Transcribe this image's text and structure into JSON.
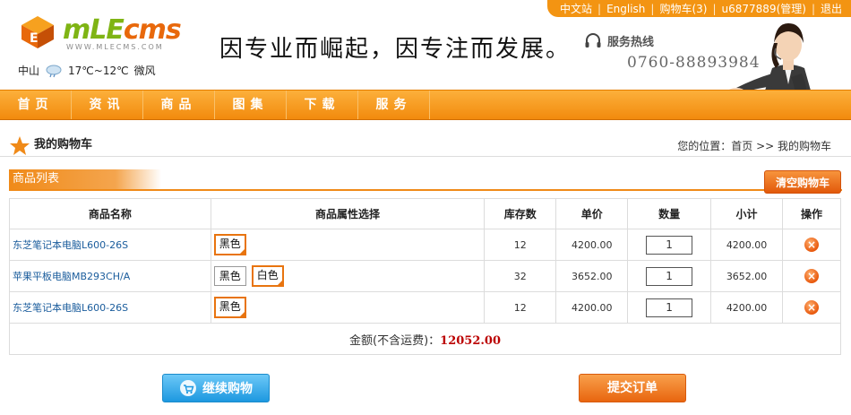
{
  "topbar": {
    "items": [
      "中文站",
      "English",
      "购物车(3)",
      "u6877889(管理)",
      "退出"
    ]
  },
  "header": {
    "logo_text_a": "mLE",
    "logo_text_b": "cms",
    "logo_sub": "WWW.MLECMS.COM",
    "city": "中山",
    "weather": "17℃~12℃",
    "wind": "微风",
    "slogan": "因专业而崛起，因专注而发展。",
    "hotline_label": "服务热线",
    "hotline_number": "0760-88893984"
  },
  "nav": {
    "items": [
      "首页",
      "资讯",
      "商品",
      "图集",
      "下载",
      "服务"
    ]
  },
  "page": {
    "title": "我的购物车",
    "breadcrumb": "您的位置：首页 >> 我的购物车"
  },
  "cart": {
    "section_title": "商品列表",
    "clear_label": "清空购物车",
    "columns": [
      "商品名称",
      "商品属性选择",
      "库存数",
      "单价",
      "数量",
      "小计",
      "操作"
    ],
    "rows": [
      {
        "name": "东芝笔记本电脑L600-26S",
        "attrs": [
          "黑色"
        ],
        "selected": [
          "黑色"
        ],
        "stock": "12",
        "price": "4200.00",
        "qty": "1",
        "subtotal": "4200.00"
      },
      {
        "name": "苹果平板电脑MB293CH/A",
        "attrs": [
          "黑色",
          "白色"
        ],
        "selected": [
          "白色"
        ],
        "stock": "32",
        "price": "3652.00",
        "qty": "1",
        "subtotal": "3652.00"
      },
      {
        "name": "东芝笔记本电脑L600-26S",
        "attrs": [
          "黑色"
        ],
        "selected": [
          "黑色"
        ],
        "stock": "12",
        "price": "4200.00",
        "qty": "1",
        "subtotal": "4200.00"
      }
    ],
    "total_label": "金额(不含运费)：",
    "total_value": "12052.00",
    "continue_label": "继续购物",
    "submit_label": "提交订单"
  },
  "colors": {
    "accent": "#f39412",
    "link": "#1a5c9c",
    "total": "#bb0000"
  }
}
